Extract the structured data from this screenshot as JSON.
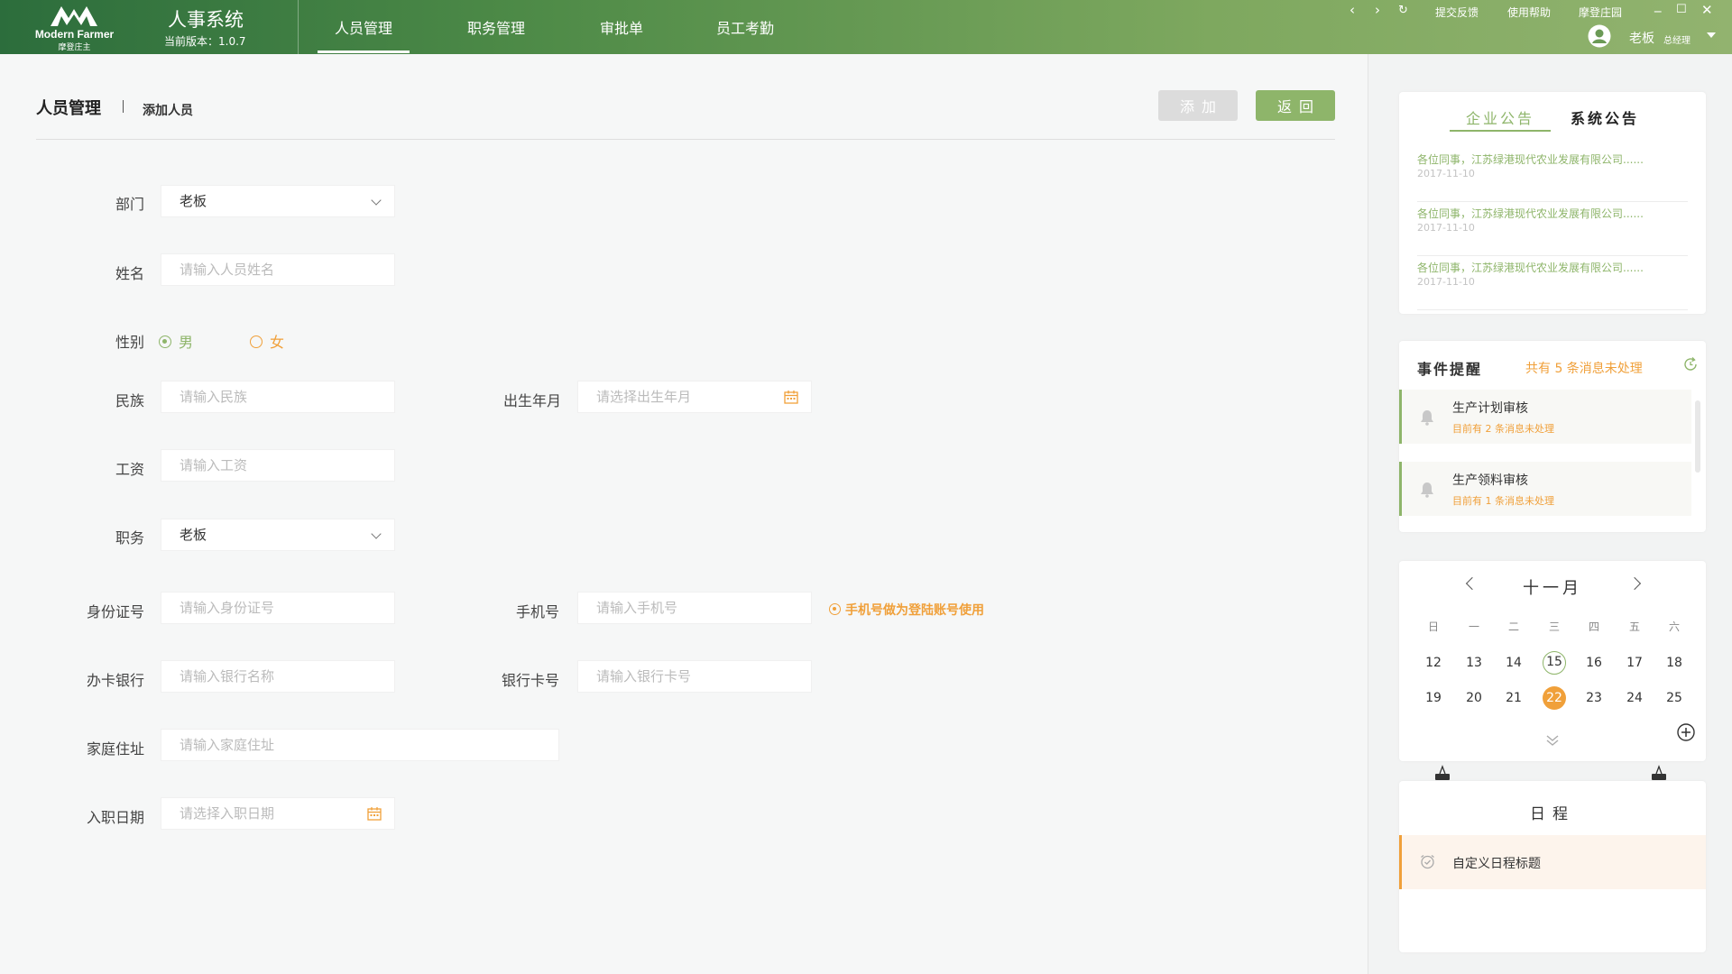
{
  "header": {
    "logo_en": "Modern Farmer",
    "logo_cn": "摩登庄主",
    "app_title": "人事系统",
    "version": "当前版本：1.0.7",
    "tabs": [
      {
        "label": "人员管理",
        "active": true
      },
      {
        "label": "职务管理",
        "active": false
      },
      {
        "label": "审批单",
        "active": false
      },
      {
        "label": "员工考勤",
        "active": false
      }
    ],
    "links": {
      "feedback": "提交反馈",
      "help": "使用帮助",
      "garden": "摩登庄园"
    },
    "window": {
      "back": "‹",
      "forward": "›",
      "refresh": "↻",
      "minimize": "_",
      "maximize": "☐",
      "close": "✕"
    },
    "user": {
      "name": "老板",
      "role": "总经理"
    }
  },
  "page": {
    "title": "人员管理",
    "subtitle": "添加人员",
    "add_button": "添加",
    "back_button": "返回"
  },
  "form": {
    "department": {
      "label": "部门",
      "value": "老板"
    },
    "name": {
      "label": "姓名",
      "placeholder": "请输入人员姓名"
    },
    "gender": {
      "label": "性别",
      "male": "男",
      "female": "女",
      "selected": "男"
    },
    "ethnicity": {
      "label": "民族",
      "placeholder": "请输入民族"
    },
    "birth": {
      "label": "出生年月",
      "placeholder": "请选择出生年月"
    },
    "salary": {
      "label": "工资",
      "placeholder": "请输入工资"
    },
    "position": {
      "label": "职务",
      "value": "老板"
    },
    "id_card": {
      "label": "身份证号",
      "placeholder": "请输入身份证号"
    },
    "phone": {
      "label": "手机号",
      "placeholder": "请输入手机号",
      "hint": "手机号做为登陆账号使用"
    },
    "bank": {
      "label": "办卡银行",
      "placeholder": "请输入银行名称"
    },
    "bank_card": {
      "label": "银行卡号",
      "placeholder": "请输入银行卡号"
    },
    "address": {
      "label": "家庭住址",
      "placeholder": "请输入家庭住址"
    },
    "join_date": {
      "label": "入职日期",
      "placeholder": "请选择入职日期"
    }
  },
  "sidebar": {
    "notice_tabs": [
      {
        "label": "企业公告",
        "active": true
      },
      {
        "label": "系统公告",
        "active": false
      }
    ],
    "notices": [
      {
        "title": "各位同事，江苏绿港现代农业发展有限公司......",
        "date": "2017-11-10"
      },
      {
        "title": "各位同事，江苏绿港现代农业发展有限公司......",
        "date": "2017-11-10"
      },
      {
        "title": "各位同事，江苏绿港现代农业发展有限公司......",
        "date": "2017-11-10"
      }
    ],
    "events": {
      "title": "事件提醒",
      "count_text": "共有 5 条消息未处理",
      "items": [
        {
          "name": "生产计划审核",
          "sub": "目前有  2  条消息未处理"
        },
        {
          "name": "生产领料审核",
          "sub": "目前有  1  条消息未处理"
        }
      ]
    },
    "calendar": {
      "month": "十一月",
      "weekdays": [
        "日",
        "一",
        "二",
        "三",
        "四",
        "五",
        "六"
      ],
      "weeks": [
        [
          "12",
          "13",
          "14",
          "15",
          "16",
          "17",
          "18"
        ],
        [
          "19",
          "20",
          "21",
          "22",
          "23",
          "24",
          "25"
        ]
      ],
      "today": "15",
      "selected": "22"
    },
    "schedule": {
      "title": "日程",
      "item": "自定义日程标题"
    }
  },
  "colors": {
    "brand_green": "#8eb56a",
    "accent_orange": "#f0a03a",
    "header_dark": "#2c6d3c"
  }
}
